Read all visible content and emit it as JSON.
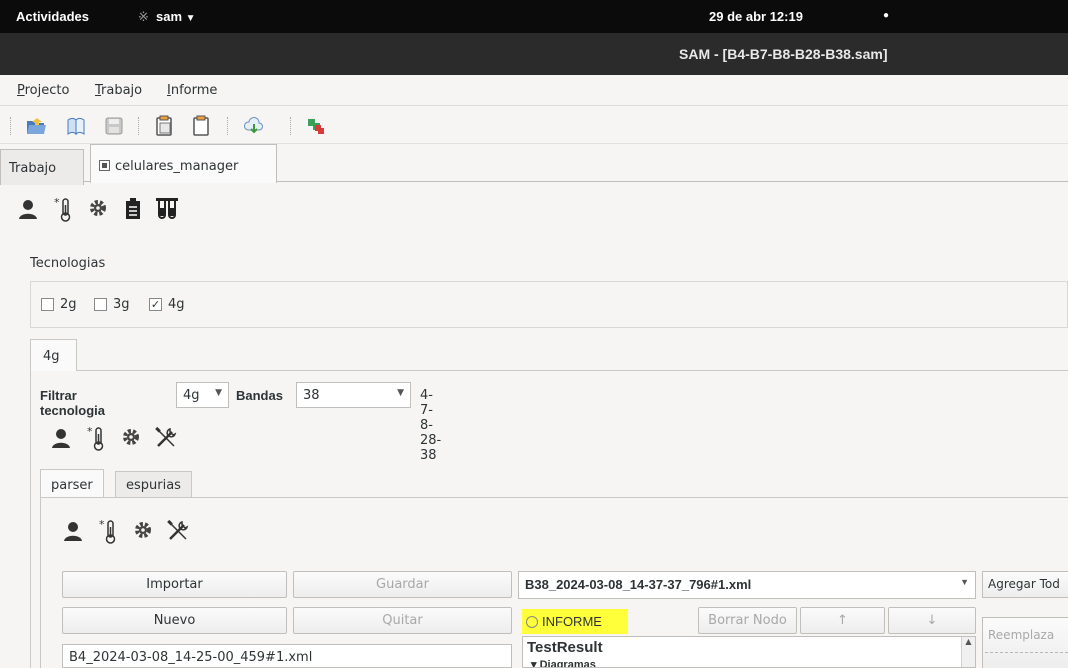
{
  "topbar": {
    "activities": "Actividades",
    "app": "sam",
    "clock": "29 de abr  12:19",
    "dot": "●"
  },
  "window": {
    "title": "SAM - [B4-B7-B8-B28-B38.sam]"
  },
  "menu": [
    {
      "mnemonic": "P",
      "rest": "rojecto"
    },
    {
      "mnemonic": "T",
      "rest": "rabajo"
    },
    {
      "mnemonic": "I",
      "rest": "nforme"
    }
  ],
  "toolbar_icons": [
    "open-folder-icon",
    "book-icon",
    "save-icon",
    "paste-icon",
    "clipboard-icon",
    "cloud-download-icon",
    "puzzle-icon"
  ],
  "tabs": {
    "trabajo": "Trabajo",
    "manager": "celulares_manager"
  },
  "tecnologias": {
    "label": "Tecnologias",
    "options": [
      {
        "label": "2g",
        "checked": false
      },
      {
        "label": "3g",
        "checked": false
      },
      {
        "label": "4g",
        "checked": true
      }
    ]
  },
  "tech_tab": "4g",
  "filter": {
    "label": "Filtrar tecnologia",
    "tech_value": "4g",
    "bandas_label": "Bandas",
    "bandas_value": "38",
    "bands_summary": "4-7-8-28-38"
  },
  "subtabs": {
    "parser": "parser",
    "espurias": "espurias"
  },
  "buttons": {
    "importar": "Importar",
    "guardar": "Guardar",
    "nuevo": "Nuevo",
    "quitar": "Quitar",
    "borrar_nodo": "Borrar Nodo",
    "up": "↑",
    "down": "↓",
    "agregar_todo": "Agregar Tod",
    "reemplazar": "Reemplaza"
  },
  "xml_file": "B38_2024-03-08_14-37-37_796#1.xml",
  "informe": "INFORME",
  "tree": {
    "root": "TestResult",
    "child": "▾ Diagramas"
  },
  "file_list": [
    "B4_2024-03-08_14-25-00_459#1.xml"
  ],
  "colors": {
    "highlight": "#ffff3a",
    "topbar": "#0b0b0b",
    "titlebar": "#2b2b2b"
  }
}
